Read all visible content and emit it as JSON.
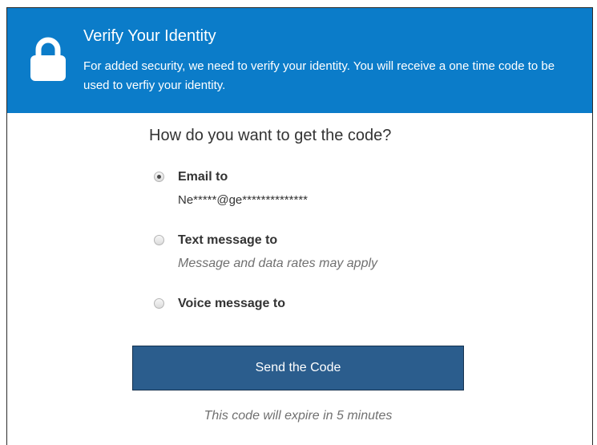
{
  "banner": {
    "title": "Verify Your Identity",
    "description": "For added security, we need to verify your identity. You will receive a one time code to be used to verfiy your identity.",
    "icon": "lock-icon",
    "background_color": "#0b7cc9"
  },
  "question": "How do you want to get the code?",
  "options": [
    {
      "label": "Email to",
      "sub": "Ne*****@ge**************",
      "selected": true
    },
    {
      "label": "Text message to",
      "sub": "Message and data rates may apply",
      "selected": false
    },
    {
      "label": "Voice message to",
      "sub": "",
      "selected": false
    }
  ],
  "send_button": {
    "label": "Send the Code",
    "color": "#2b5d8d"
  },
  "expiry_note": "This code will expire in 5 minutes"
}
